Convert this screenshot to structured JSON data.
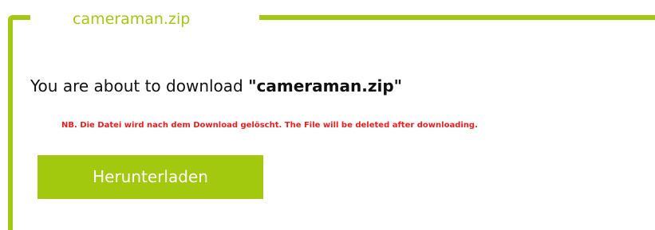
{
  "panel": {
    "title": "cameraman.zip"
  },
  "message": {
    "prefix": "You are about to download ",
    "filename": "\"cameraman.zip\""
  },
  "note": {
    "text": "NB. Die Datei wird nach dem Download gelöscht. The File will be deleted after downloading."
  },
  "download_button": {
    "label": "Herunterladen"
  },
  "colors": {
    "accent": "#a3c90f",
    "warning": "#ee1d1d",
    "text": "#111111"
  }
}
